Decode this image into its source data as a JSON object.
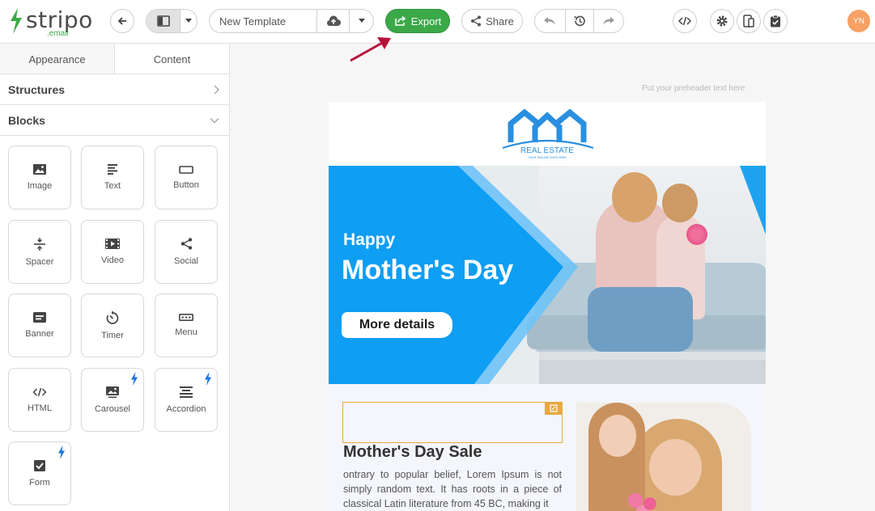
{
  "app": {
    "logo_word": "stripo",
    "logo_sub": ".email"
  },
  "toolbar": {
    "template_name": "New Template",
    "export_label": "Export",
    "share_label": "Share",
    "avatar_initials": "YN"
  },
  "panel": {
    "tabs": [
      {
        "label": "Appearance",
        "active": false
      },
      {
        "label": "Content",
        "active": true
      }
    ],
    "sections": {
      "structures": "Structures",
      "blocks": "Blocks"
    },
    "blocks": [
      {
        "label": "Image",
        "icon": "image-icon"
      },
      {
        "label": "Text",
        "icon": "text-icon"
      },
      {
        "label": "Button",
        "icon": "button-icon"
      },
      {
        "label": "Spacer",
        "icon": "spacer-icon"
      },
      {
        "label": "Video",
        "icon": "video-icon"
      },
      {
        "label": "Social",
        "icon": "social-icon"
      },
      {
        "label": "Banner",
        "icon": "banner-icon"
      },
      {
        "label": "Timer",
        "icon": "timer-icon"
      },
      {
        "label": "Menu",
        "icon": "menu-icon"
      },
      {
        "label": "HTML",
        "icon": "html-icon"
      },
      {
        "label": "Carousel",
        "icon": "carousel-icon",
        "bolt": true
      },
      {
        "label": "Accordion",
        "icon": "accordion-icon",
        "bolt": true
      },
      {
        "label": "Form",
        "icon": "form-icon",
        "bolt": true
      }
    ]
  },
  "email": {
    "preheader": "Put your preheader text here",
    "logo_text": "REAL ESTATE",
    "logo_tagline": "YOUR TAGLINE GOES HERE",
    "hero_line1": "Happy",
    "hero_line2": "Mother's Day",
    "hero_button": "More details",
    "sale_title": "Mother's Day Sale",
    "sale_text": "ontrary to popular belief, Lorem Ipsum is not simply random text. It has roots in a piece of classical Latin literature from 45 BC, making it"
  },
  "colors": {
    "brand_green": "#3ba948",
    "hero_blue": "#0e9ef3",
    "accent_orange": "#e8a840",
    "avatar_orange": "#f7a164",
    "arrow_red": "#b5123a"
  }
}
